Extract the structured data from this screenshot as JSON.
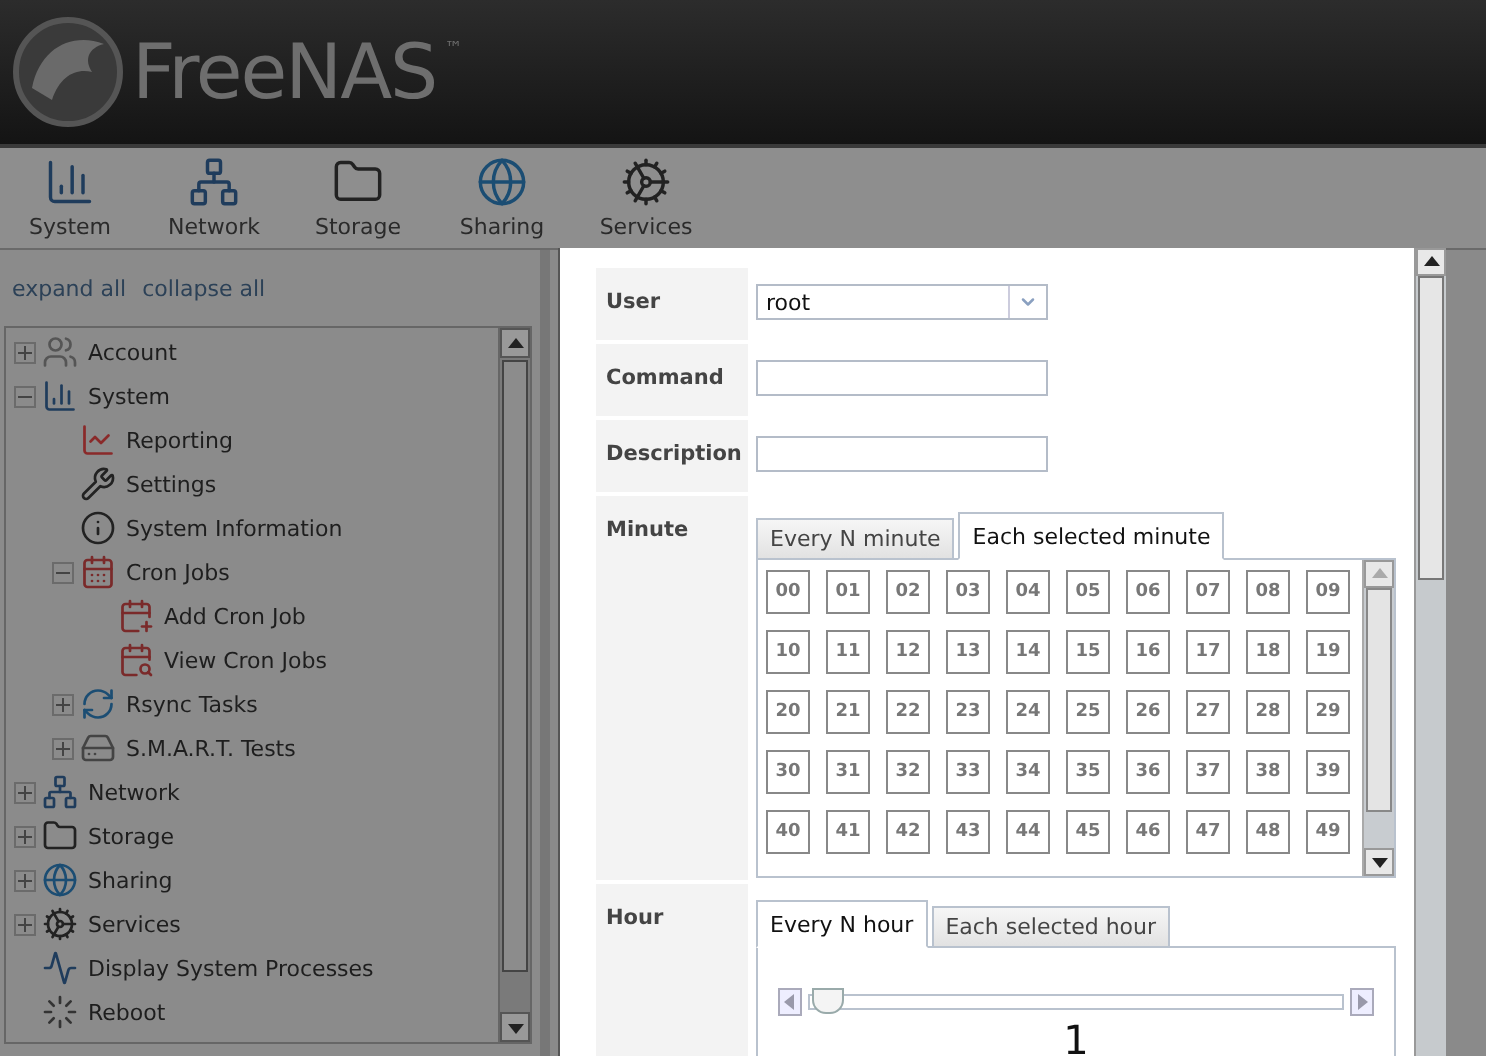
{
  "logo": {
    "name": "FreeNAS",
    "trademark": "™"
  },
  "toolbar": [
    {
      "label": "System"
    },
    {
      "label": "Network"
    },
    {
      "label": "Storage"
    },
    {
      "label": "Sharing"
    },
    {
      "label": "Services"
    }
  ],
  "sidebar": {
    "links": [
      "expand all",
      "collapse all"
    ],
    "tree": [
      {
        "label": "Account",
        "kind": "group",
        "expanded": false
      },
      {
        "label": "System",
        "kind": "group",
        "expanded": true,
        "children": [
          {
            "label": "Reporting",
            "kind": "leaf"
          },
          {
            "label": "Settings",
            "kind": "leaf"
          },
          {
            "label": "System Information",
            "kind": "leaf"
          },
          {
            "label": "Cron Jobs",
            "kind": "group",
            "expanded": true,
            "children": [
              {
                "label": "Add Cron Job",
                "kind": "leaf"
              },
              {
                "label": "View Cron Jobs",
                "kind": "leaf"
              }
            ]
          },
          {
            "label": "Rsync Tasks",
            "kind": "group",
            "expanded": false
          },
          {
            "label": "S.M.A.R.T. Tests",
            "kind": "group",
            "expanded": false
          }
        ]
      },
      {
        "label": "Network",
        "kind": "group",
        "expanded": false
      },
      {
        "label": "Storage",
        "kind": "group",
        "expanded": false
      },
      {
        "label": "Sharing",
        "kind": "group",
        "expanded": false
      },
      {
        "label": "Services",
        "kind": "group",
        "expanded": false
      },
      {
        "label": "Display System Processes",
        "kind": "leaf"
      },
      {
        "label": "Reboot",
        "kind": "leaf"
      }
    ]
  },
  "dialog": {
    "fields": [
      {
        "label": "User",
        "kind": "select",
        "value": "root"
      },
      {
        "label": "Command",
        "kind": "text"
      },
      {
        "label": "Description",
        "kind": "text"
      }
    ],
    "minute": {
      "label": "Minute",
      "tabs": [
        {
          "label": "Every N minute",
          "selected": false
        },
        {
          "label": "Each selected minute",
          "selected": true
        }
      ],
      "cells": [
        {
          "label": "00",
          "selected": false
        },
        {
          "label": "01",
          "selected": false
        },
        {
          "label": "02",
          "selected": false
        },
        {
          "label": "03",
          "selected": false
        },
        {
          "label": "04",
          "selected": false
        },
        {
          "label": "05",
          "selected": false
        },
        {
          "label": "06",
          "selected": false
        },
        {
          "label": "07",
          "selected": false
        },
        {
          "label": "08",
          "selected": false
        },
        {
          "label": "09",
          "selected": false
        },
        {
          "label": "10",
          "selected": false
        },
        {
          "label": "11",
          "selected": false
        },
        {
          "label": "12",
          "selected": false
        },
        {
          "label": "13",
          "selected": false
        },
        {
          "label": "14",
          "selected": false
        },
        {
          "label": "15",
          "selected": false
        },
        {
          "label": "16",
          "selected": false
        },
        {
          "label": "17",
          "selected": false
        },
        {
          "label": "18",
          "selected": false
        },
        {
          "label": "19",
          "selected": false
        },
        {
          "label": "20",
          "selected": false
        },
        {
          "label": "21",
          "selected": false
        },
        {
          "label": "22",
          "selected": false
        },
        {
          "label": "23",
          "selected": false
        },
        {
          "label": "24",
          "selected": false
        },
        {
          "label": "25",
          "selected": false
        },
        {
          "label": "26",
          "selected": false
        },
        {
          "label": "27",
          "selected": false
        },
        {
          "label": "28",
          "selected": false
        },
        {
          "label": "29",
          "selected": false
        },
        {
          "label": "30",
          "selected": false
        },
        {
          "label": "31",
          "selected": false
        },
        {
          "label": "32",
          "selected": false
        },
        {
          "label": "33",
          "selected": false
        },
        {
          "label": "34",
          "selected": false
        },
        {
          "label": "35",
          "selected": false
        },
        {
          "label": "36",
          "selected": false
        },
        {
          "label": "37",
          "selected": false
        },
        {
          "label": "38",
          "selected": false
        },
        {
          "label": "39",
          "selected": false
        },
        {
          "label": "40",
          "selected": false
        },
        {
          "label": "41",
          "selected": false
        },
        {
          "label": "42",
          "selected": false
        },
        {
          "label": "43",
          "selected": false
        },
        {
          "label": "44",
          "selected": false
        },
        {
          "label": "45",
          "selected": false
        },
        {
          "label": "46",
          "selected": false
        },
        {
          "label": "47",
          "selected": false
        },
        {
          "label": "48",
          "selected": false
        },
        {
          "label": "49",
          "selected": false
        }
      ]
    },
    "hour": {
      "label": "Hour",
      "tabs": [
        {
          "label": "Every N hour",
          "selected": true
        },
        {
          "label": "Each selected hour",
          "selected": false
        }
      ],
      "slider": {
        "level": 0.03
      },
      "value": "1"
    }
  }
}
